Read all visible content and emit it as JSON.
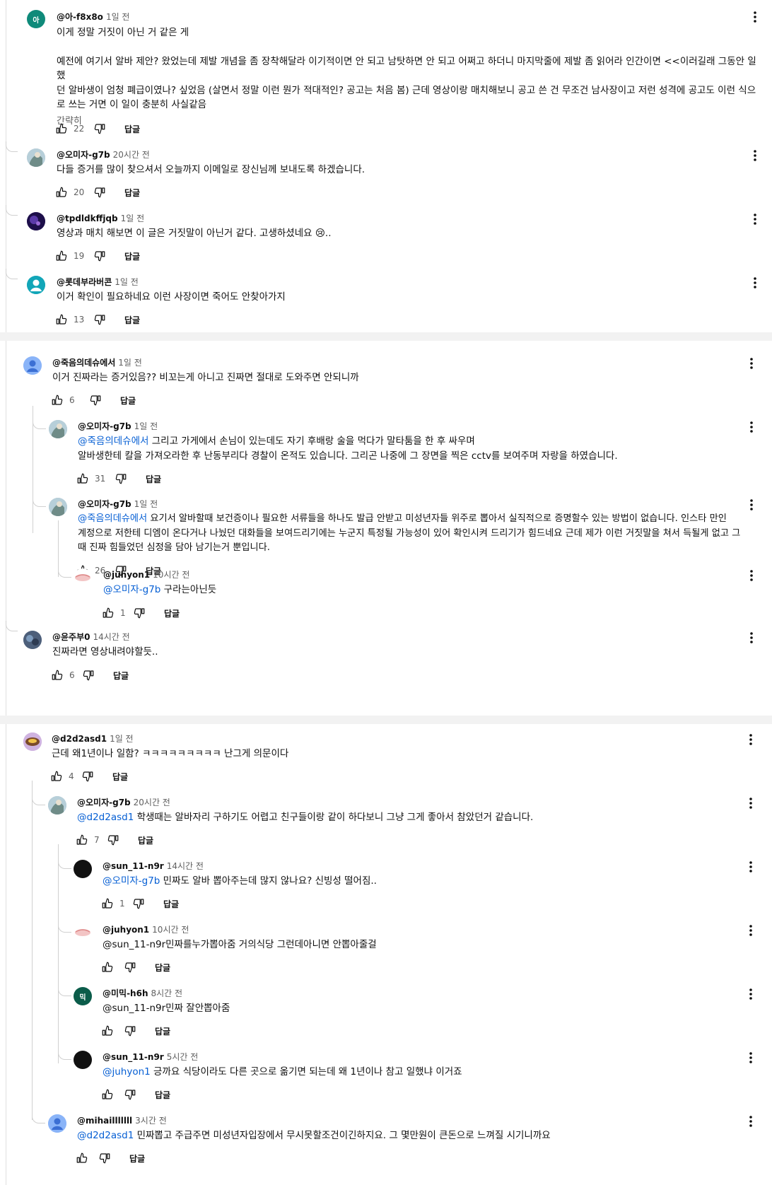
{
  "reply_label": "답글",
  "comments": [
    {
      "author": "@아-f8x8o",
      "time": "1일 전",
      "avatar_initial": "아",
      "text_lines": [
        "이게 정말 거짓이 아닌 거 같은 게"
      ],
      "text_lines_b": [
        "예전에 여기서 알바 제안? 왔었는데 제발 개념을 좀 장착해달라 이기적이면 안 되고 남탓하면 안 되고 어쩌고 하더니 마지막줄에 제발 좀 읽어라 인간이면 <<이러길래 그동안 일했",
        "던 알바생이 엄청 폐급이였나? 싶었음 (살면서 정말 이런 뭔가 적대적인? 공고는 처음 봄) 근데 영상이랑 매치해보니 공고 쓴 건 무조건 남사장이고 저런 성격에 공고도 이런 식으",
        "로 쓰는 거면 이 일이 충분히 사실같음"
      ],
      "read_more": "간략히",
      "likes": "22"
    },
    {
      "author": "@오미자-g7b",
      "time": "20시간 전",
      "text": "다들 증거를 많이 찾으셔서 오늘까지 이메일로 장신님께 보내도록 하겠습니다.",
      "likes": "20"
    },
    {
      "author": "@tpdldkffjqb",
      "time": "1일 전",
      "text": "영상과 매치 해보면 이 글은 거짓말이 아닌거 같다. 고생하셨네요 😢..",
      "likes": "19"
    },
    {
      "author": "@롯데부라버콘",
      "time": "1일 전",
      "text": "이거 확인이 필요하네요 이런 사장이면 죽어도 안찾아가지",
      "likes": "13"
    },
    {
      "author": "@죽음의데슈에서",
      "time": "1일 전",
      "text": "이거 진짜라는 증거있음?? 비꼬는게 아니고 진짜면 절대로 도와주면 안되니까",
      "likes": "6"
    },
    {
      "author": "@오미자-g7b",
      "time": "1일 전",
      "mention": "@죽음의데슈에서",
      "text_lines": [
        " 그리고 가게에서 손님이 있는데도 자기 후배랑 술을 먹다가 말타툼을 한 후 싸우며",
        "알바생한테 칼을 가져오라한 후 난동부리다 경찰이 온적도 있습니다. 그리곤 나중에 그 장면을 찍은 cctv를 보여주며 자랑을 하였습니다."
      ],
      "likes": "31"
    },
    {
      "author": "@오미자-g7b",
      "time": "1일 전",
      "mention": "@죽음의데슈에서",
      "text_lines": [
        "  요기서 알바할때 보건증이나 필요한 서류들을 하나도 발급 안받고 미성년자들 위주로 뽑아서 실직적으로 증명할수 있는 방법이 없습니다. 인스타 만인",
        "계정으로 저한테 디엠이 온다거나 나눴던 대화들을 보여드리기에는 누군지 특정될 가능성이 있어 확인시켜 드리기가 힘드네요 근데 제가 이런 거짓말을 쳐서 득될게 없고 그",
        "때 진짜 힘들었던 심정을 담아 남기는거 뿐입니다."
      ],
      "likes": "26"
    },
    {
      "author": "@juhyon1",
      "time": "10시간 전",
      "mention": "@오미자-g7b",
      "text": " 구라는아닌듯",
      "likes": "1"
    },
    {
      "author": "@윤주부0",
      "time": "14시간 전",
      "text": "진짜라면 영상내려야할듯..",
      "likes": "6"
    },
    {
      "author": "@d2d2asd1",
      "time": "1일 전",
      "text": "근데 왜1년이나 일함? ㅋㅋㅋㅋㅋㅋㅋㅋㅋ 난그게 의문이다",
      "likes": "4"
    },
    {
      "author": "@오미자-g7b",
      "time": "20시간 전",
      "mention": "@d2d2asd1",
      "text": " 학생때는 알바자리 구하기도 어렵고 친구들이랑 같이 하다보니 그냥 그게 좋아서 참았던거 같습니다.",
      "likes": "7"
    },
    {
      "author": "@sun_11-n9r",
      "time": "14시간 전",
      "mention": "@오미자-g7b",
      "text": " 민짜도 알바 뽑아주는데 많지 않나요? 신빙성 떨어짐..",
      "likes": "1"
    },
    {
      "author": "@juhyon1",
      "time": "10시간 전",
      "text": "@sun_11-n9r민짜를누가뽑아줌 거의식당 그런데아니면 안뽑아줄걸",
      "likes": ""
    },
    {
      "author": "@미믹-h6h",
      "time": "8시간 전",
      "avatar_initial": "믹",
      "text": "@sun_11-n9r민짜 잘안뽑아줌",
      "likes": ""
    },
    {
      "author": "@sun_11-n9r",
      "time": "5시간 전",
      "mention": "@juhyon1",
      "text": " 긍까요 식당이라도 다른 곳으로 옮기면 되는데 왜 1년이나 참고 일했냐 이거죠",
      "likes": ""
    },
    {
      "author": "@mihailllllll",
      "time": "3시간 전",
      "mention": "@d2d2asd1",
      "text": " 민짜뽑고 주급주면 미성년자입장에서 무시못할조건이긴하지요. 그 몇만원이 큰돈으로 느껴질 시기니까요",
      "likes": ""
    }
  ],
  "colors": {
    "mention": "#065fd4",
    "text": "#0f0f0f",
    "secondary": "#606060"
  }
}
